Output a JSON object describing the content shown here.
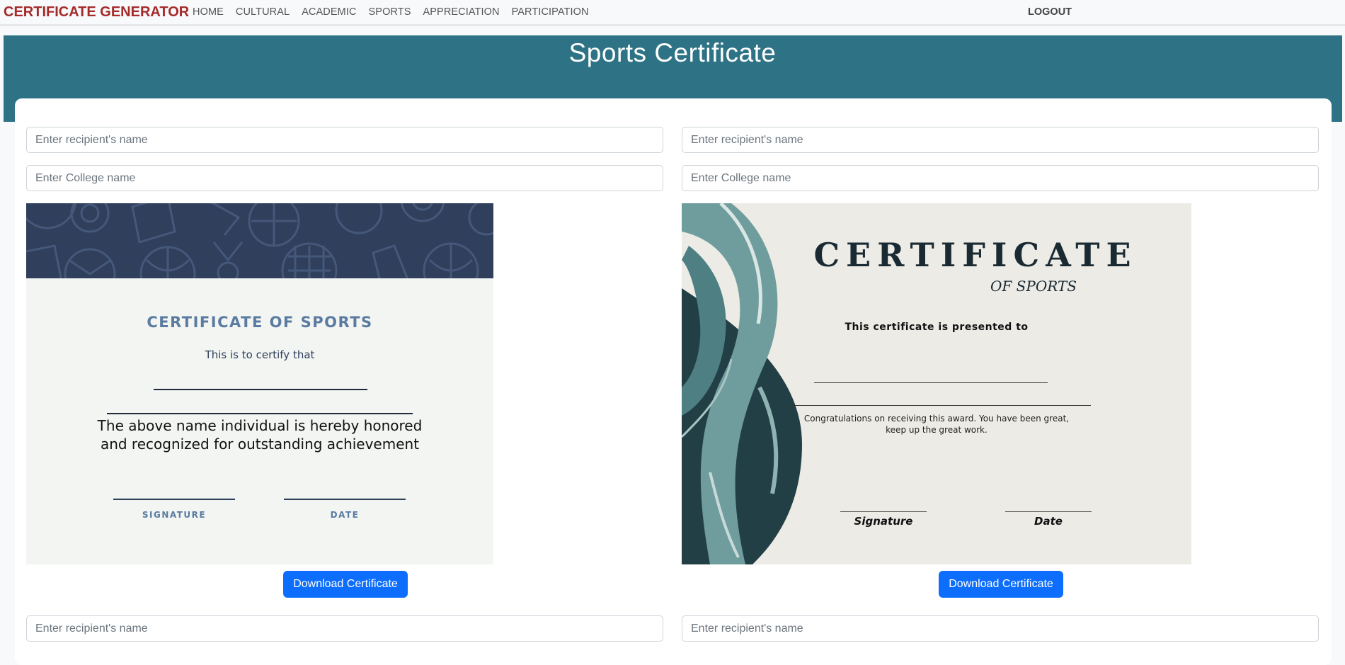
{
  "navbar": {
    "brand": "CERTIFICATE GENERATOR",
    "links": [
      "HOME",
      "CULTURAL",
      "ACADEMIC",
      "SPORTS",
      "APPRECIATION",
      "PARTICIPATION"
    ],
    "logout": "LOGOUT"
  },
  "header": {
    "title": "Sports Certificate"
  },
  "forms": {
    "name_placeholder": "Enter recipient's name",
    "college_placeholder": "Enter College name",
    "download_label": "Download Certificate"
  },
  "certificate_1": {
    "title": "CERTIFICATE OF SPORTS",
    "certify": "This is to certify that",
    "body_line1": "The above name individual is hereby honored",
    "body_line2": "and recognized for outstanding achievement",
    "signature_label": "SIGNATURE",
    "date_label": "DATE"
  },
  "certificate_2": {
    "title": "CERTIFICATE",
    "subtitle": "OF SPORTS",
    "presented": "This certificate is presented to",
    "congrats_line1": "Congratulations on receiving this award. You have been great,",
    "congrats_line2": "keep up the great work.",
    "signature_label": "Signature",
    "date_label": "Date"
  },
  "colors": {
    "brand": "#a52a2a",
    "header_band": "#2e7385",
    "button": "#0d6efd",
    "cert1_banner": "#2f3f5c",
    "cert1_accent": "#5b7ba0"
  }
}
